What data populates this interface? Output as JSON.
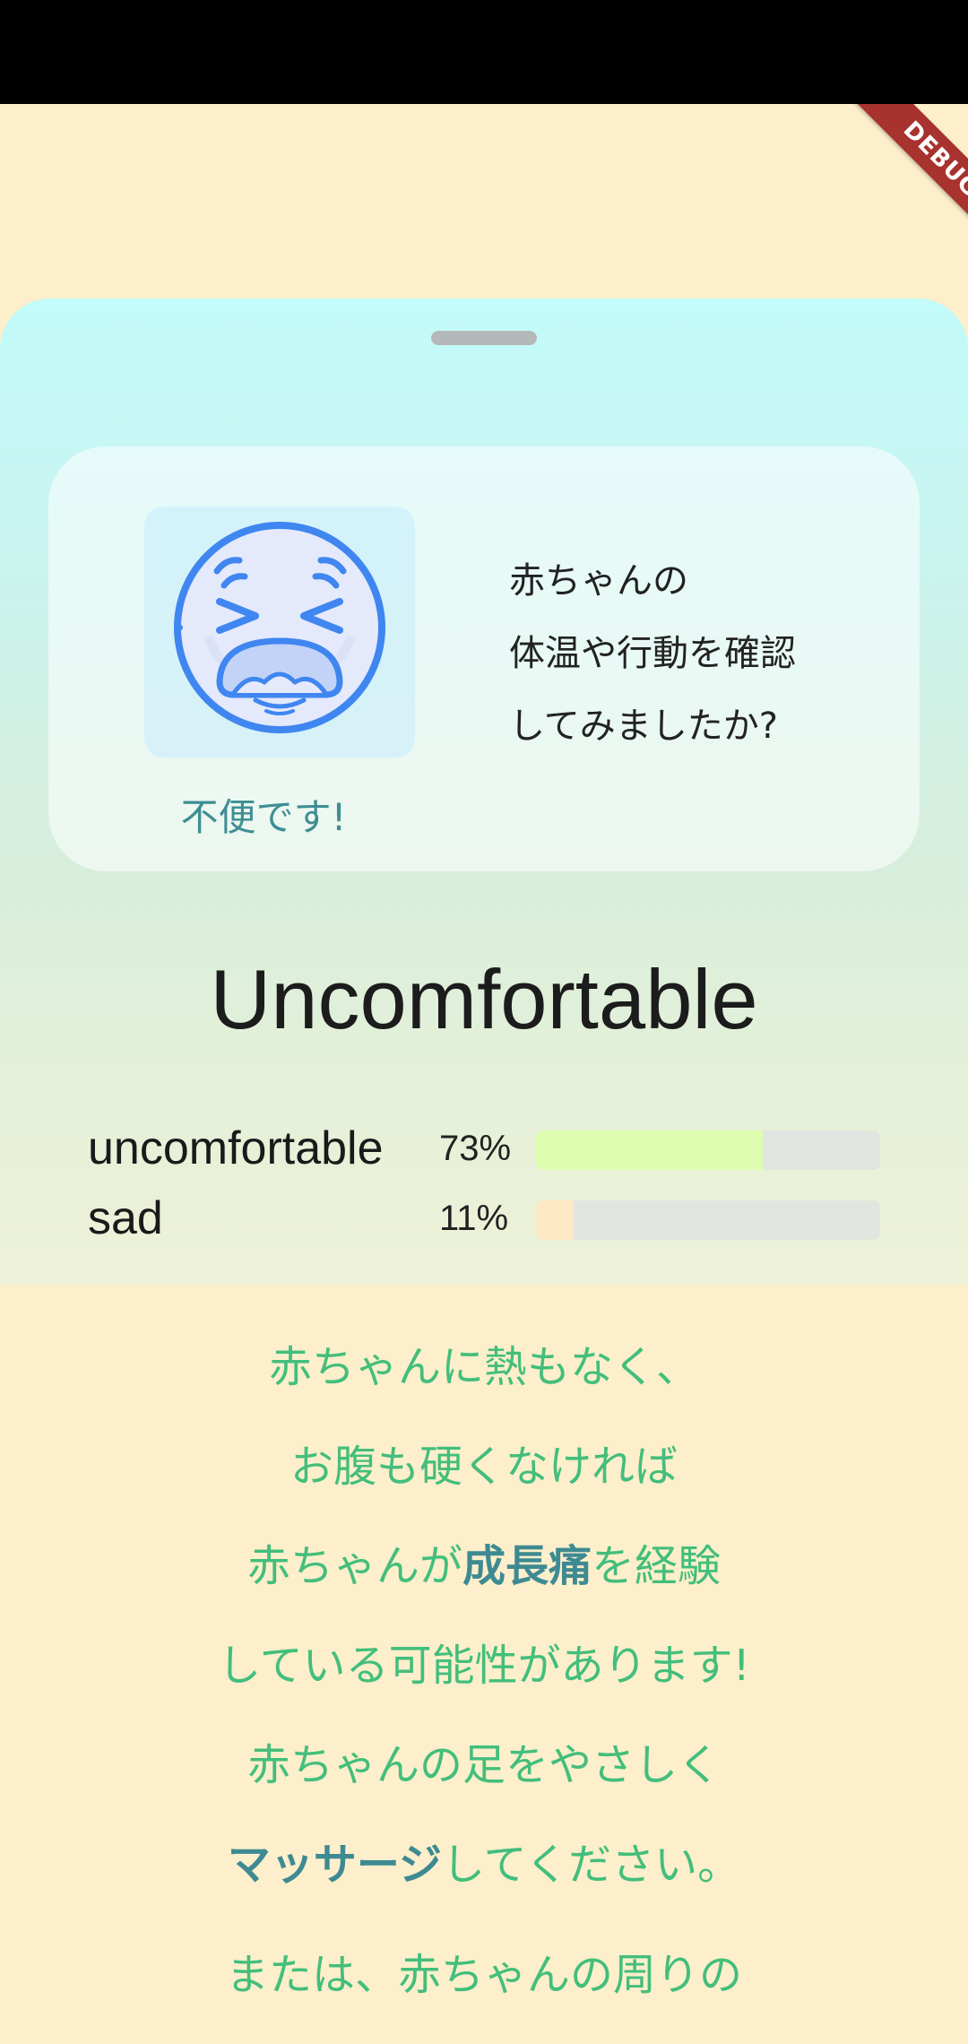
{
  "debug_banner": "DEBUG",
  "card": {
    "emoji_icon": "tired-face-icon",
    "emoji_label": "不便です!",
    "question_lines": [
      "赤ちゃんの",
      "体温や行動を確認",
      "してみましたか?"
    ]
  },
  "result": {
    "title": "Uncomfortable",
    "stats": [
      {
        "name": "uncomfortable",
        "percent_label": "73%",
        "fraction": 0.66,
        "color": "#DDFCB0"
      },
      {
        "name": "sad",
        "percent_label": "11%",
        "fraction": 0.11,
        "color": "#FDE9C3"
      }
    ]
  },
  "advice": {
    "line1": "赤ちゃんに熱もなく、",
    "line2": "お腹も硬くなければ",
    "line3_pre": "赤ちゃんが",
    "line3_strong": "成長痛",
    "line3_post": "を経験",
    "line4": "している可能性があります!",
    "line5": "赤ちゃんの足をやさしく",
    "line6_strong": "マッサージ",
    "line6_post": "してください。",
    "line7": "または、赤ちゃんの周りの"
  },
  "colors": {
    "background": "#FDEFCB",
    "advice_text": "#43BE7C",
    "accent_text": "#3E8A93",
    "debug_ribbon": "#A8322E"
  }
}
